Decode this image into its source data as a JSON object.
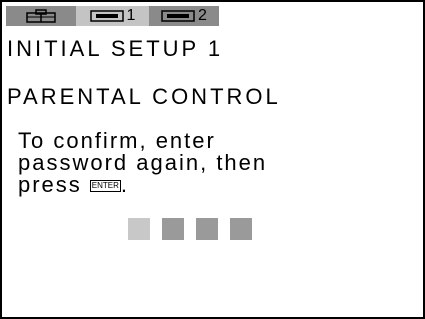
{
  "tabs": [
    {
      "icon": "setup-icon",
      "number": ""
    },
    {
      "icon": "disc-icon",
      "number": "1"
    },
    {
      "icon": "disc-icon",
      "number": "2"
    }
  ],
  "screen": {
    "title": "INITIAL SETUP 1",
    "section": "PARENTAL CONTROL",
    "message_lines": [
      "To confirm, enter",
      "password again, then",
      "press"
    ],
    "enter_key": "ENTER",
    "period": "."
  },
  "password": {
    "length": 4,
    "active_index": 0
  },
  "colors": {
    "tab_dark": "#8a8a8a",
    "tab_light": "#c4c4c4",
    "square": "#9a9a9a",
    "square_active": "#c8c8c8"
  }
}
